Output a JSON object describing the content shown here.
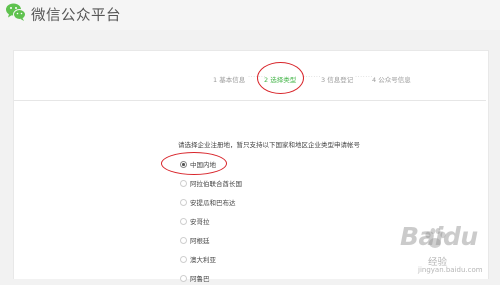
{
  "header": {
    "brand": "微信公众平台",
    "logo_icon": "wechat-logo-icon"
  },
  "steps": [
    {
      "label": "1 基本信息",
      "active": false
    },
    {
      "label": "2 选择类型",
      "active": true
    },
    {
      "label": "3 信息登记",
      "active": false
    },
    {
      "label": "4 公众号信息",
      "active": false
    }
  ],
  "step_separator": "·······",
  "instruction": "请选择企业注册地，暂只支持以下国家和地区企业类型申请帐号",
  "regions": {
    "selected": "中国内地",
    "items": [
      "中国内地",
      "阿拉伯联合酋长国",
      "安提瓜和巴布达",
      "安哥拉",
      "阿根廷",
      "澳大利亚",
      "阿鲁巴"
    ]
  },
  "watermark": {
    "text": "Baidu",
    "sub": "经验",
    "url": "jingyan.baidu.com"
  },
  "colors": {
    "accent_green": "#44b549",
    "annotation_red": "#d8242a",
    "wechat_green": "#44b549"
  }
}
